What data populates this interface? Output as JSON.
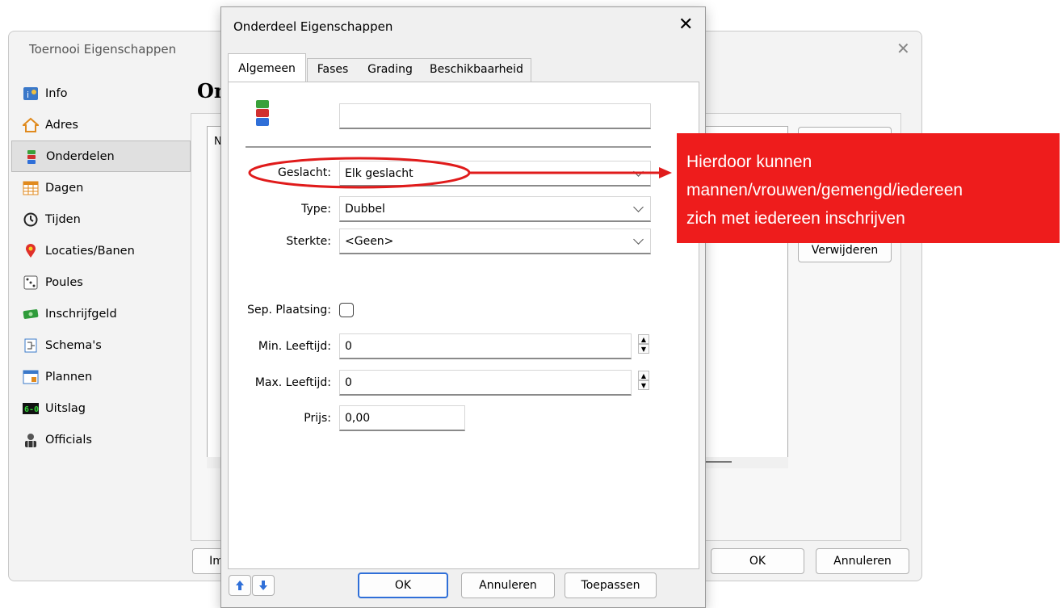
{
  "background_window": {
    "title": "Toernooi Eigenschappen",
    "heading": "On",
    "nav": [
      {
        "label": "Info",
        "icon": "info-icon"
      },
      {
        "label": "Adres",
        "icon": "house-icon"
      },
      {
        "label": "Onderdelen",
        "icon": "stack-icon",
        "selected": true
      },
      {
        "label": "Dagen",
        "icon": "calendar-grid-icon"
      },
      {
        "label": "Tijden",
        "icon": "clock-icon"
      },
      {
        "label": "Locaties/Banen",
        "icon": "location-pin-icon"
      },
      {
        "label": "Poules",
        "icon": "dice-icon"
      },
      {
        "label": "Inschrijfgeld",
        "icon": "money-icon"
      },
      {
        "label": "Schema's",
        "icon": "schema-icon"
      },
      {
        "label": "Plannen",
        "icon": "planner-icon"
      },
      {
        "label": "Uitslag",
        "icon": "scoreboard-icon"
      },
      {
        "label": "Officials",
        "icon": "official-icon"
      }
    ],
    "list_fragment": "N",
    "delete_button": "Verwijderen",
    "import_button": "Im",
    "ok_button": "OK",
    "cancel_button": "Annuleren"
  },
  "dialog": {
    "title": "Onderdeel Eigenschappen",
    "tabs": [
      "Algemeen",
      "Fases",
      "Grading",
      "Beschikbaarheid"
    ],
    "name_value": "",
    "fields": {
      "gender_label": "Geslacht:",
      "gender_value": "Elk geslacht",
      "type_label": "Type:",
      "type_value": "Dubbel",
      "strength_label": "Sterkte:",
      "strength_value": "<Geen>",
      "sep_label": "Sep. Plaatsing:",
      "min_age_label": "Min. Leeftijd:",
      "min_age_value": "0",
      "max_age_label": "Max. Leeftijd:",
      "max_age_value": "0",
      "price_label": "Prijs:",
      "price_value": "0,00"
    },
    "buttons": {
      "ok": "OK",
      "cancel": "Annuleren",
      "apply": "Toepassen"
    }
  },
  "annotation": {
    "lines": [
      "Hierdoor kunnen",
      "mannen/vrouwen/gemengd/iedereen",
      "zich met iedereen inschrijven"
    ],
    "color": "#ee1c1c"
  }
}
